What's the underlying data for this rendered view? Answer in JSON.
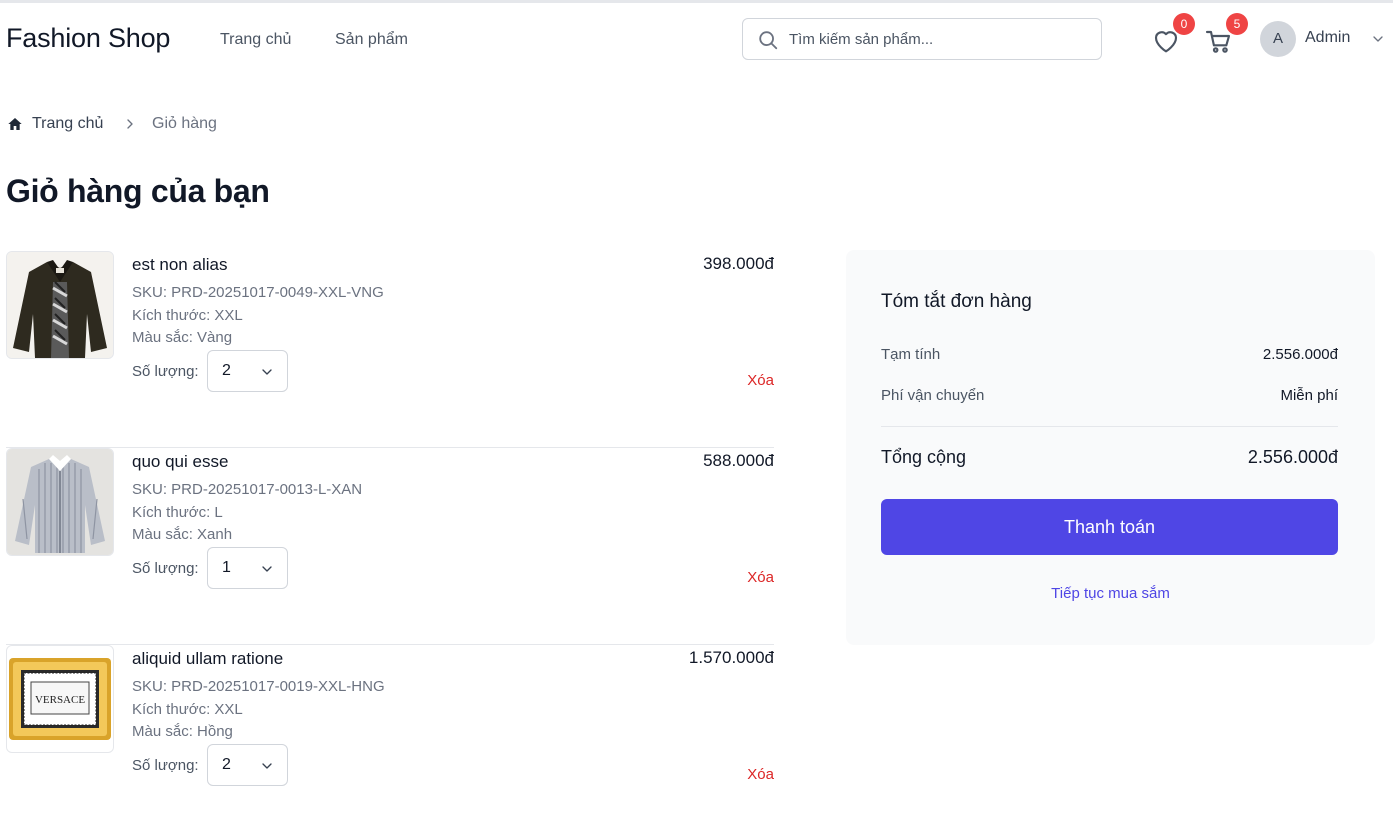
{
  "header": {
    "brand": "Fashion Shop",
    "nav": {
      "home": "Trang chủ",
      "products": "Sản phẩm"
    },
    "search": {
      "placeholder": "Tìm kiếm sản phẩm...",
      "value": ""
    },
    "wishlist_count": "0",
    "cart_count": "5",
    "user": {
      "initial": "A",
      "name": "Admin"
    }
  },
  "breadcrumb": {
    "home": "Trang chủ",
    "current": "Giỏ hàng"
  },
  "page_title": "Giỏ hàng của bạn",
  "cart": {
    "items": [
      {
        "name": "est non alias",
        "sku": "SKU: PRD-20251017-0049-XXL-VNG",
        "size": "Kích thước: XXL",
        "color": "Màu sắc: Vàng",
        "qty_label": "Số lượng:",
        "qty": "2",
        "price": "398.000đ",
        "remove": "Xóa",
        "image": "dark-jacket"
      },
      {
        "name": "quo qui esse",
        "sku": "SKU: PRD-20251017-0013-L-XAN",
        "size": "Kích thước: L",
        "color": "Màu sắc: Xanh",
        "qty_label": "Số lượng:",
        "qty": "1",
        "price": "588.000đ",
        "remove": "Xóa",
        "image": "striped-shirt"
      },
      {
        "name": "aliquid ullam ratione",
        "sku": "SKU: PRD-20251017-0019-XXL-HNG",
        "size": "Kích thước: XXL",
        "color": "Màu sắc: Hồng",
        "qty_label": "Số lượng:",
        "qty": "2",
        "price": "1.570.000đ",
        "remove": "Xóa",
        "image": "versace-tray",
        "image_text": "VERSACE"
      }
    ]
  },
  "summary": {
    "title": "Tóm tắt đơn hàng",
    "subtotal_label": "Tạm tính",
    "subtotal_value": "2.556.000đ",
    "shipping_label": "Phí vận chuyển",
    "shipping_value": "Miễn phí",
    "total_label": "Tổng cộng",
    "total_value": "2.556.000đ",
    "checkout": "Thanh toán",
    "continue": "Tiếp tục mua sắm"
  },
  "colors": {
    "accent": "#4f46e5",
    "danger": "#dc2626",
    "badge": "#ef4444"
  }
}
